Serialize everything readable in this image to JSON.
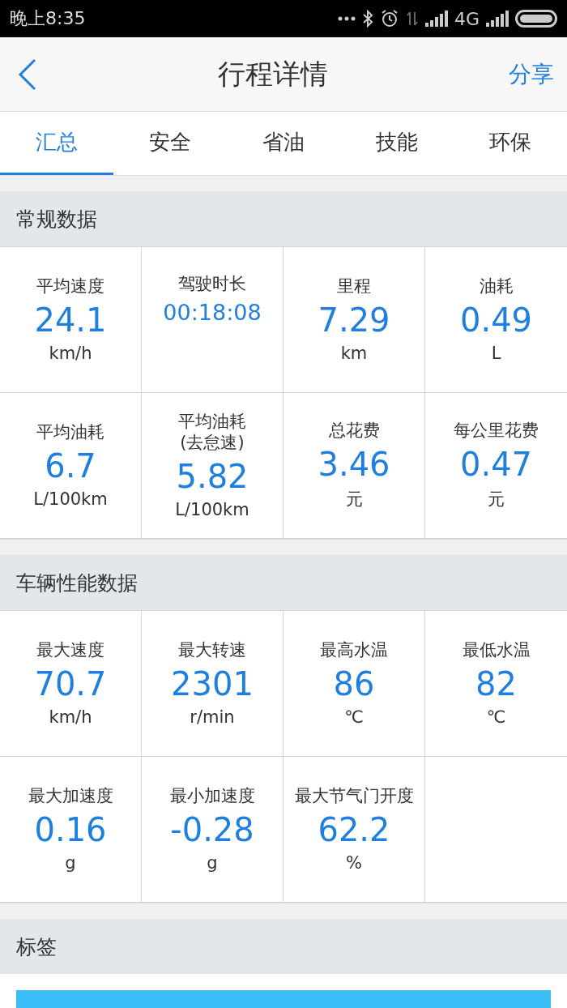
{
  "status_bar": {
    "time": "晚上8:35",
    "network": "4G"
  },
  "header": {
    "title": "行程详情",
    "action": "分享"
  },
  "tabs": [
    {
      "label": "汇总",
      "selected": true
    },
    {
      "label": "安全",
      "selected": false
    },
    {
      "label": "省油",
      "selected": false
    },
    {
      "label": "技能",
      "selected": false
    },
    {
      "label": "环保",
      "selected": false
    }
  ],
  "sections": [
    {
      "title": "常规数据",
      "kind": "stats",
      "cells": [
        {
          "label": "平均速度",
          "value": "24.1",
          "unit": "km/h",
          "kind": "number"
        },
        {
          "label": "驾驶时长",
          "value": "00:18:08",
          "kind": "time"
        },
        {
          "label": "里程",
          "value": "7.29",
          "unit": "km",
          "kind": "number"
        },
        {
          "label": "油耗",
          "value": "0.49",
          "unit": "L",
          "kind": "number"
        },
        {
          "label": "平均油耗",
          "value": "6.7",
          "unit": "L/100km",
          "kind": "number"
        },
        {
          "label": "平均油耗\n(去怠速)",
          "value": "5.82",
          "unit": "L/100km",
          "kind": "number"
        },
        {
          "label": "总花费",
          "value": "3.46",
          "unit": "元",
          "kind": "number"
        },
        {
          "label": "每公里花费",
          "value": "0.47",
          "unit": "元",
          "kind": "number"
        }
      ]
    },
    {
      "title": "车辆性能数据",
      "kind": "stats",
      "cells": [
        {
          "label": "最大速度",
          "value": "70.7",
          "unit": "km/h",
          "kind": "number"
        },
        {
          "label": "最大转速",
          "value": "2301",
          "unit": "r/min",
          "kind": "number"
        },
        {
          "label": "最高水温",
          "value": "86",
          "unit": "℃",
          "kind": "number"
        },
        {
          "label": "最低水温",
          "value": "82",
          "unit": "℃",
          "kind": "number"
        },
        {
          "label": "最大加速度",
          "value": "0.16",
          "unit": "g",
          "kind": "number"
        },
        {
          "label": "最小加速度",
          "value": "-0.28",
          "unit": "g",
          "kind": "number"
        },
        {
          "label": "最大节气门开度",
          "value": "62.2",
          "unit": "%",
          "kind": "number"
        }
      ]
    },
    {
      "title": "标签",
      "kind": "tags"
    }
  ]
}
